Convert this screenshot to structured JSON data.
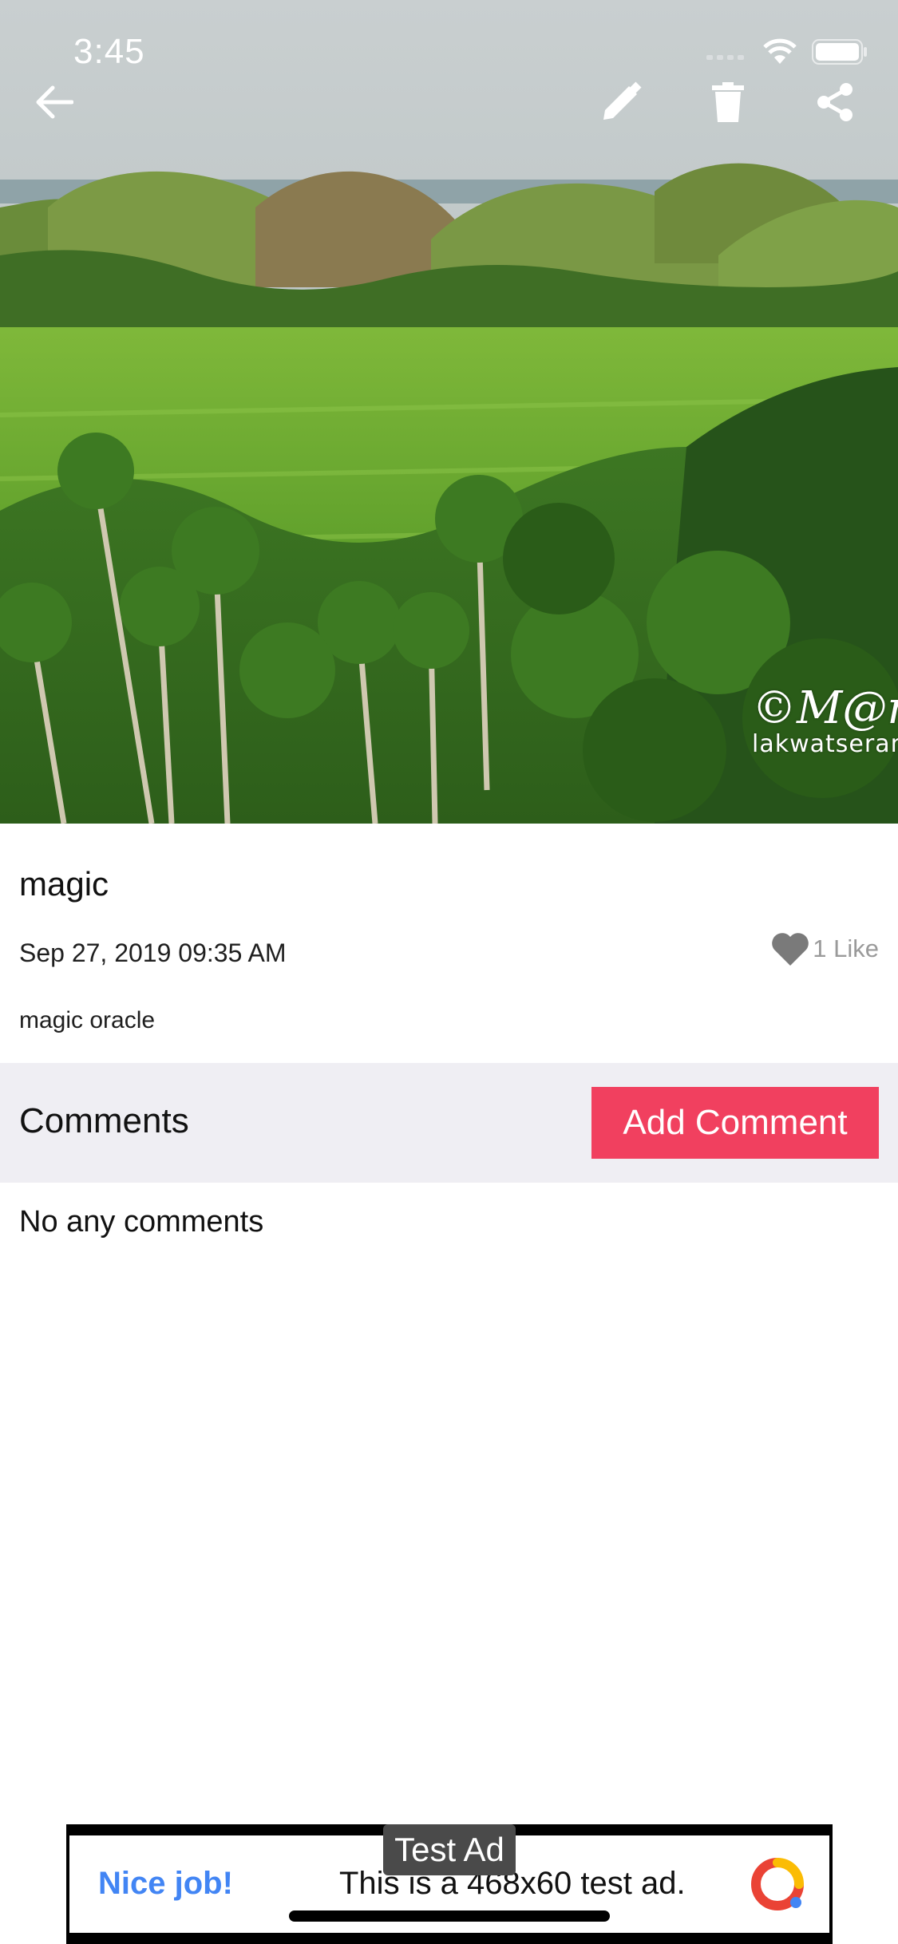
{
  "status_bar": {
    "time": "3:45"
  },
  "toolbar": {
    "back_icon": "arrow-left-icon",
    "edit_icon": "pencil-icon",
    "delete_icon": "trash-icon",
    "share_icon": "share-icon"
  },
  "photo": {
    "watermark_line1": "©M@nch",
    "watermark_line2": "lakwatseran"
  },
  "post": {
    "title": "magic",
    "date": "Sep 27, 2019 09:35 AM",
    "like_label": "1 Like",
    "description": "magic oracle"
  },
  "comments": {
    "heading": "Comments",
    "add_button": "Add Comment",
    "empty_text": "No any comments"
  },
  "ad": {
    "badge": "Test Ad",
    "nice_job": "Nice job!",
    "text": "This is a 468x60 test ad."
  },
  "colors": {
    "accent": "#f1405f",
    "comments_bar_bg": "#efeef3",
    "like_gray": "#9a9a9a",
    "ad_link_blue": "#4285f4"
  }
}
